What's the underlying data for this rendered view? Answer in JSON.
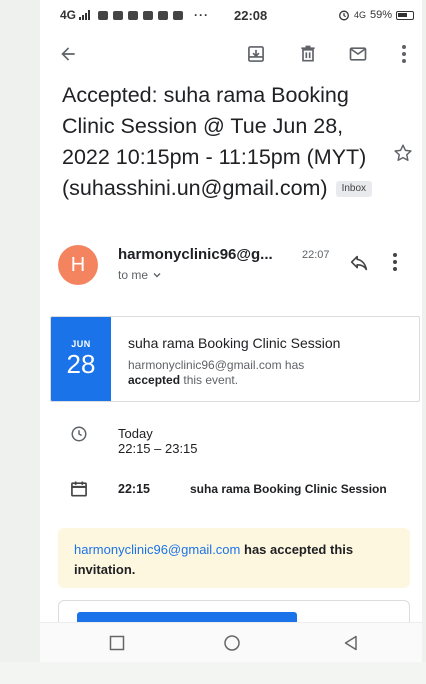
{
  "status_bar": {
    "network": "4G",
    "dots": "···",
    "time": "22:08",
    "alarm_network": "4G",
    "battery": "59%"
  },
  "toolbar": {
    "icons": [
      "back-arrow-icon",
      "archive-icon",
      "delete-icon",
      "mail-icon",
      "more-vert-icon"
    ]
  },
  "email": {
    "subject": "Accepted: suha rama Booking Clinic Session @ Tue Jun 28, 2022 10:15pm - 11:15pm (MYT) (suhasshini.un@gmail.com)",
    "label": "Inbox",
    "sender_initial": "H",
    "sender": "harmonyclinic96@g...",
    "time": "22:07",
    "recipient": "to me"
  },
  "event_card": {
    "month": "JUN",
    "day": "28",
    "title": "suha rama Booking Clinic Session",
    "desc_prefix": "harmonyclinic96@gmail.com has",
    "desc_bold": "accepted",
    "desc_suffix": "this event."
  },
  "event_time": {
    "day": "Today",
    "range": "22:15 – 23:15"
  },
  "calendar_row": {
    "time": "22:15",
    "title": "suha rama Booking Clinic Session"
  },
  "notice": {
    "email": "harmonyclinic96@gmail.com",
    "text": "has accepted this invitation."
  },
  "colors": {
    "accent": "#1a73e8",
    "avatar": "#f4845f",
    "notice_bg": "#fef7e0"
  }
}
